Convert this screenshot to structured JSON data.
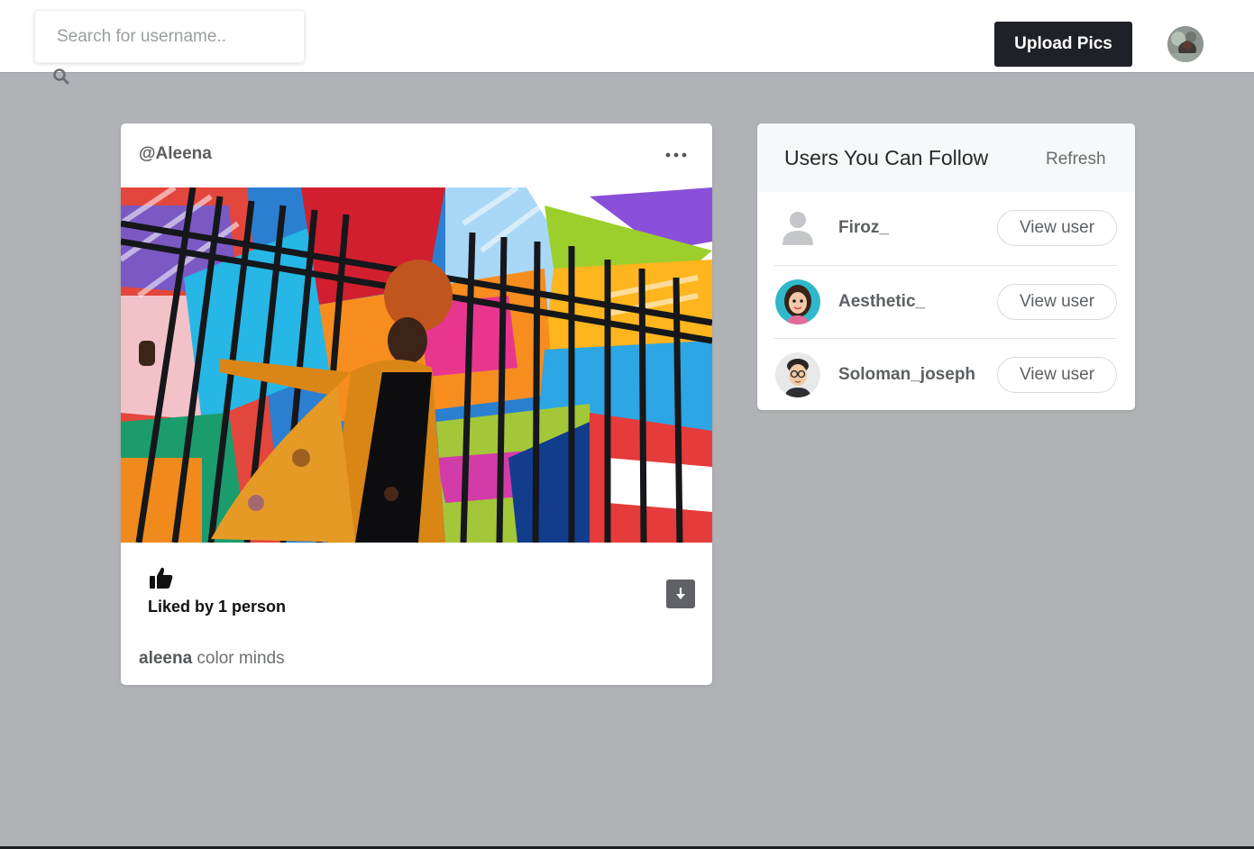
{
  "header": {
    "search_placeholder": "Search for username..",
    "upload_label": "Upload Pics",
    "search_icon": "search-icon",
    "avatar_icon": "profile-avatar"
  },
  "post": {
    "username": "@Aleena",
    "more_icon": "more-horizontal-icon",
    "likes_text": "Liked by 1 person",
    "caption_user": "aleena",
    "caption_text": " color minds",
    "like_icon": "thumbs-up-icon",
    "download_icon": "download-icon"
  },
  "suggestions": {
    "title": "Users You Can Follow",
    "refresh_label": "Refresh",
    "users": [
      {
        "name": "Firoz_",
        "button": "View user"
      },
      {
        "name": "Aesthetic_",
        "button": "View user"
      },
      {
        "name": "Soloman_joseph",
        "button": "View user"
      }
    ]
  },
  "colors": {
    "page_bg": "#b0b2b6",
    "primary_button": "#1f2126",
    "card_bg": "#ffffff"
  }
}
